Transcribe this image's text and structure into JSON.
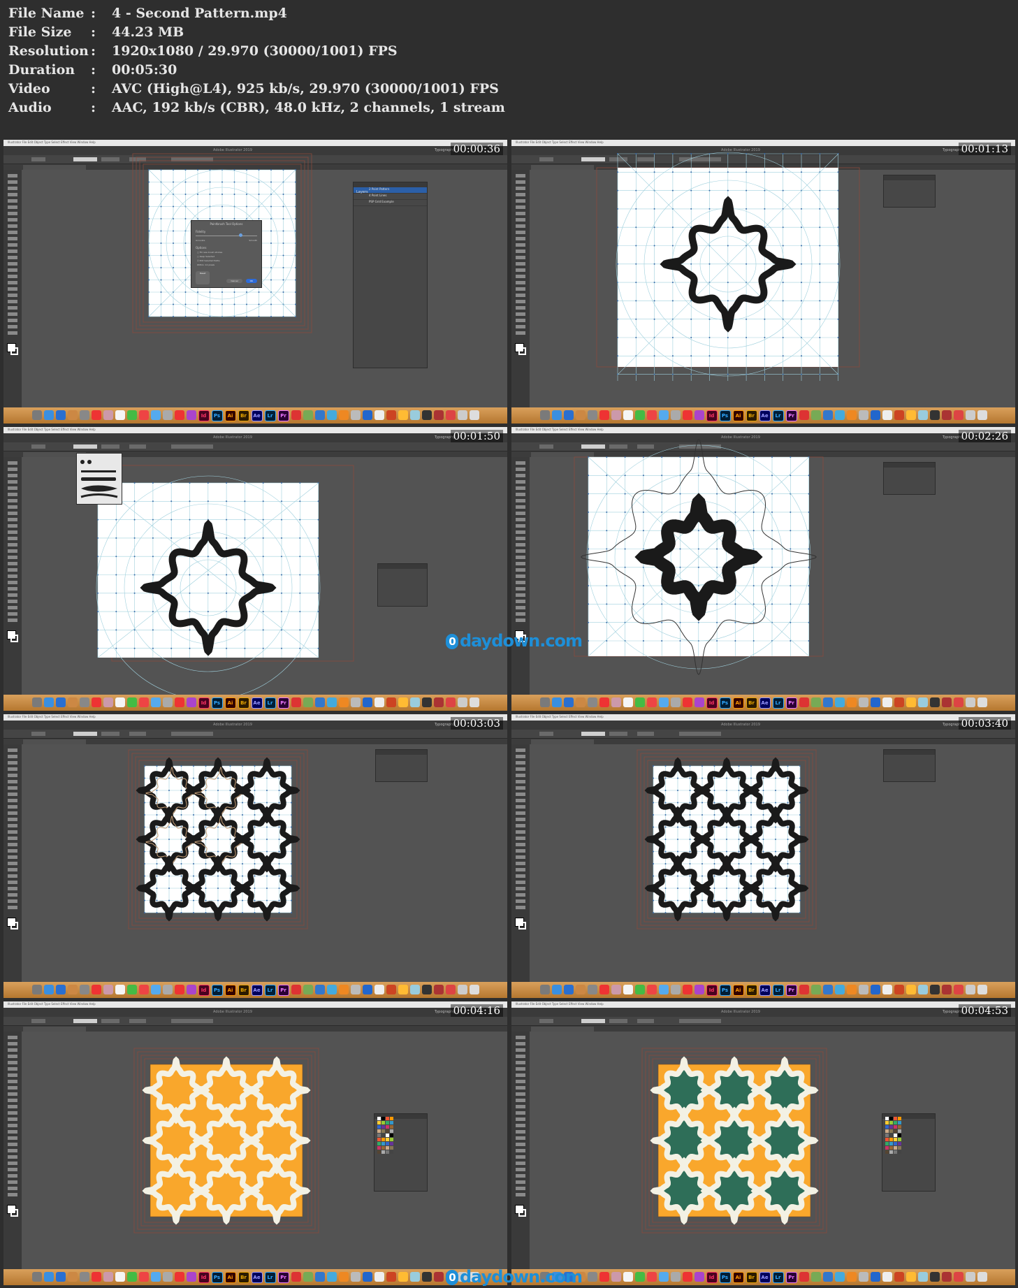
{
  "info": {
    "rows": [
      {
        "label": "File Name",
        "value": "4 - Second Pattern.mp4"
      },
      {
        "label": "File Size",
        "value": "44.23 MB"
      },
      {
        "label": "Resolution",
        "value": "1920x1080 / 29.970 (30000/1001) FPS"
      },
      {
        "label": "Duration",
        "value": "00:05:30"
      },
      {
        "label": "Video",
        "value": "AVC (High@L4), 925 kb/s, 29.970 (30000/1001) FPS"
      },
      {
        "label": "Audio",
        "value": "AAC, 192 kb/s (CBR), 48.0 kHz, 2 channels, 1 stream"
      }
    ],
    "separator": ":"
  },
  "app": {
    "title": "Adobe Illustrator 2019",
    "workspace": "Typography",
    "menu_text": "Illustrator  File  Edit  Object  Type  Select  Effect  View  Window  Help"
  },
  "thumbnails": [
    {
      "timestamp": "00:00:36"
    },
    {
      "timestamp": "00:01:13"
    },
    {
      "timestamp": "00:01:50"
    },
    {
      "timestamp": "00:02:26"
    },
    {
      "timestamp": "00:03:03"
    },
    {
      "timestamp": "00:03:40"
    },
    {
      "timestamp": "00:04:16"
    },
    {
      "timestamp": "00:04:53"
    }
  ],
  "dialog": {
    "title": "Paintbrush Tool Options",
    "fidelity": "Fidelity",
    "accurate": "Accurate",
    "smooth": "Smooth",
    "options": "Options",
    "opt1": "Fill new brush strokes",
    "opt2": "Keep Selected",
    "opt3": "Edit Selected Paths",
    "within": "Within:",
    "within_value": "12",
    "pixels": "pixels",
    "reset": "Reset",
    "cancel": "Cancel",
    "ok": "OK"
  },
  "layers_panel": {
    "tab": "Layers",
    "items": [
      "2 Point Pattern",
      "4 Point Lines",
      "PSP Grid Example"
    ]
  },
  "watermark": {
    "text": "daydown.com",
    "badge": "0"
  },
  "dock_labels": [
    "Id",
    "Ps",
    "Ai",
    "Br",
    "Ae",
    "Lr",
    "Pr"
  ],
  "colors": {
    "orange": "#F9A72C",
    "green": "#2E6E58",
    "cream": "#F3F1E4",
    "shape": "#1A1A1A",
    "grid": "#9FD0DD"
  }
}
